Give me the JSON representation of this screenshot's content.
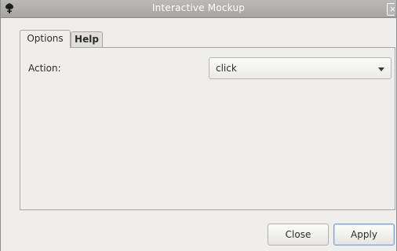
{
  "window": {
    "title": "Interactive Mockup"
  },
  "tabs": [
    {
      "label": "Options",
      "active": true
    },
    {
      "label": "Help",
      "active": false
    }
  ],
  "form": {
    "action_label": "Action:",
    "action_value": "click"
  },
  "buttons": {
    "close_label": "Close",
    "apply_label": "Apply"
  },
  "icons": {
    "window_icon": "app-icon",
    "close_icon": "close-icon",
    "dropdown_icon": "chevron-down-icon"
  },
  "colors": {
    "titlebar": "#b0aeaa",
    "background": "#efeeec",
    "apply_border": "#7c9fc6"
  }
}
